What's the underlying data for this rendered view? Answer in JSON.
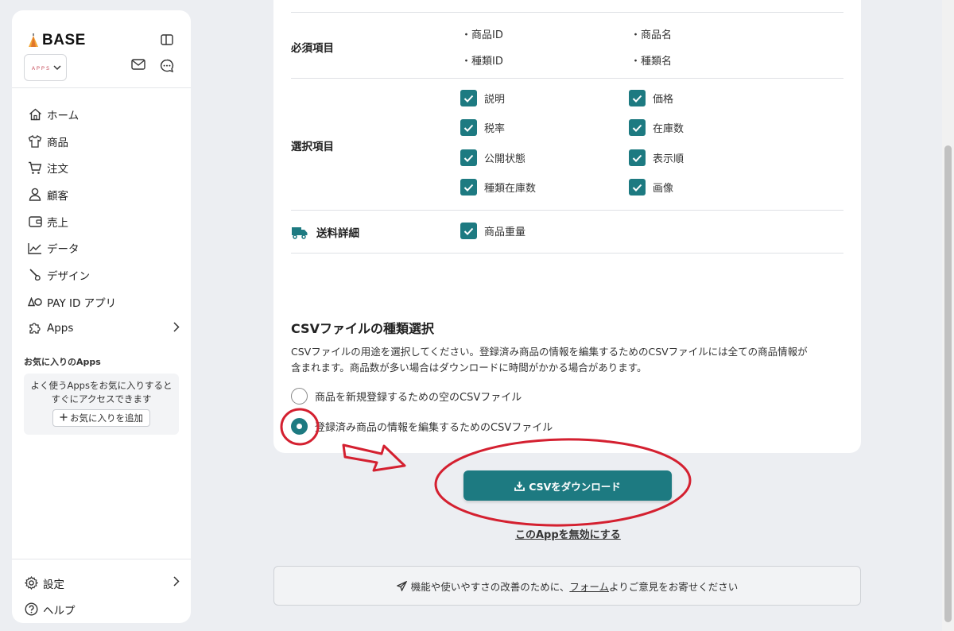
{
  "sidebar": {
    "logo_text": "BASE",
    "shop_logo_text": "ＡＰＰＳ",
    "nav": [
      {
        "label": "ホーム"
      },
      {
        "label": "商品"
      },
      {
        "label": "注文"
      },
      {
        "label": "顧客"
      },
      {
        "label": "売上"
      },
      {
        "label": "データ"
      },
      {
        "label": "デザイン"
      },
      {
        "label": "PAY ID アプリ"
      },
      {
        "label": "Apps"
      }
    ],
    "favorites_title": "お気に入りのApps",
    "favorites_desc_1": "よく使うAppsをお気に入りすると",
    "favorites_desc_2": "すぐにアクセスできます",
    "favorites_add": "お気に入りを追加",
    "bottom": [
      {
        "label": "設定"
      },
      {
        "label": "ヘルプ"
      }
    ]
  },
  "card": {
    "required": {
      "label": "必須項目",
      "items": [
        "・商品ID",
        "・商品名",
        "・種類ID",
        "・種類名"
      ]
    },
    "optional": {
      "label": "選択項目",
      "items": [
        "説明",
        "価格",
        "税率",
        "在庫数",
        "公開状態",
        "表示順",
        "種類在庫数",
        "画像"
      ]
    },
    "shipping": {
      "label": "送料詳細",
      "items": [
        "商品重量"
      ]
    },
    "csv_type": {
      "title": "CSVファイルの種類選択",
      "desc_1": "CSVファイルの用途を選択してください。登録済み商品の情報を編集するためのCSVファイルには全ての商品情報が",
      "desc_2": "含まれます。商品数が多い場合はダウンロードに時間がかかる場合があります。",
      "options": [
        {
          "label": "商品を新規登録するための空のCSVファイル",
          "selected": false
        },
        {
          "label": "登録済み商品の情報を編集するためのCSVファイル",
          "selected": true
        }
      ]
    }
  },
  "actions": {
    "download": "CSVをダウンロード",
    "disable": "このAppを無効にする"
  },
  "feedback": {
    "prefix": "機能や使いやすさの改善のために、",
    "link": "フォーム",
    "suffix": "よりご意見をお寄せください"
  },
  "colors": {
    "accent": "#1d7a81",
    "annotation": "#d42030",
    "background": "#eceef2"
  }
}
